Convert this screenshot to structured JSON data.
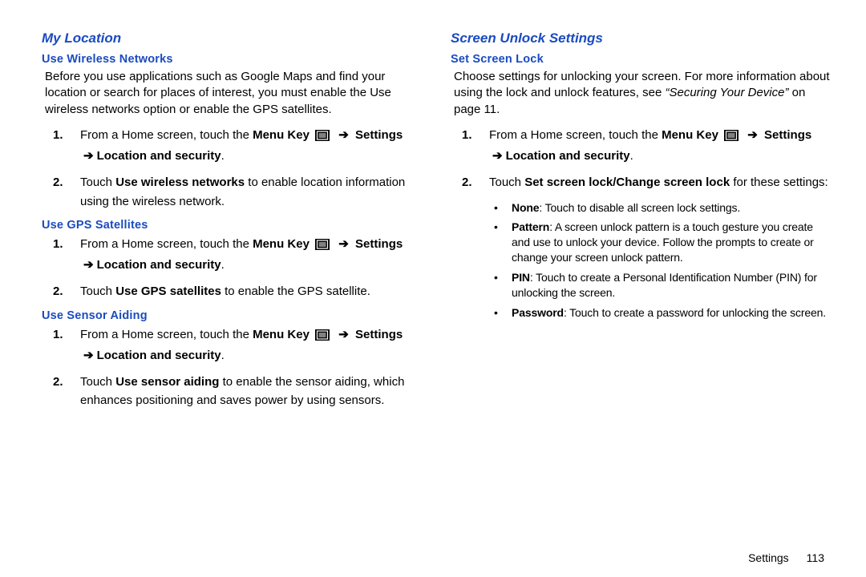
{
  "left": {
    "section_title": "My Location",
    "sub1": {
      "heading": "Use Wireless Networks",
      "intro": "Before you use applications such as Google Maps and find your location or search for places of interest, you must enable the Use wireless networks option or enable the GPS satellites.",
      "step1_num": "1.",
      "step1_pre": "From a Home screen, touch the ",
      "step1_menu": "Menu Key",
      "step1_arrow": "➔",
      "step1_settings": "Settings",
      "step1_arrow2": "➔",
      "step1_loc": "Location and security",
      "step1_end": ".",
      "step2_num": "2.",
      "step2_pre": "Touch ",
      "step2_bold": "Use wireless networks",
      "step2_post": " to enable location information using the wireless network."
    },
    "sub2": {
      "heading": "Use GPS Satellites",
      "step1_num": "1.",
      "step1_pre": "From a Home screen, touch the ",
      "step1_menu": "Menu Key",
      "step1_arrow": "➔",
      "step1_settings": "Settings",
      "step1_arrow2": "➔",
      "step1_loc": "Location and security",
      "step1_end": ".",
      "step2_num": "2.",
      "step2_pre": "Touch ",
      "step2_bold": "Use GPS satellites",
      "step2_post": " to enable the GPS satellite."
    },
    "sub3": {
      "heading": "Use Sensor Aiding",
      "step1_num": "1.",
      "step1_pre": "From a Home screen, touch the ",
      "step1_menu": "Menu Key",
      "step1_arrow": "➔",
      "step1_settings": "Settings",
      "step1_arrow2": "➔",
      "step1_loc": "Location and security",
      "step1_end": ".",
      "step2_num": "2.",
      "step2_pre": "Touch ",
      "step2_bold": "Use sensor aiding",
      "step2_post": " to enable the sensor aiding, which enhances positioning and saves power by using sensors."
    }
  },
  "right": {
    "section_title": "Screen Unlock Settings",
    "sub1": {
      "heading": "Set Screen Lock",
      "intro_pre": "Choose settings for unlocking your screen. For more information about using the lock and unlock features, see ",
      "intro_ref": "“Securing Your Device”",
      "intro_post": " on page 11.",
      "step1_num": "1.",
      "step1_pre": "From a Home screen, touch the ",
      "step1_menu": "Menu Key",
      "step1_arrow": "➔",
      "step1_settings": "Settings",
      "step1_arrow2": "➔",
      "step1_loc": "Location and security",
      "step1_end": ".",
      "step2_num": "2.",
      "step2_pre": "Touch ",
      "step2_bold": "Set screen lock/Change screen lock",
      "step2_post": " for these settings:",
      "bullets": {
        "b1_label": "None",
        "b1_text": ": Touch to disable all screen lock settings.",
        "b2_label": "Pattern",
        "b2_text": ": A screen unlock pattern is a touch gesture you create and use to unlock your device. Follow the prompts to create or change your screen unlock pattern.",
        "b3_label": "PIN",
        "b3_text": ": Touch to create a Personal Identification Number (PIN) for unlocking the screen.",
        "b4_label": "Password",
        "b4_text": ": Touch to create a password for unlocking the screen."
      }
    }
  },
  "footer": {
    "label": "Settings",
    "page": "113"
  },
  "bullet_dot": "•"
}
